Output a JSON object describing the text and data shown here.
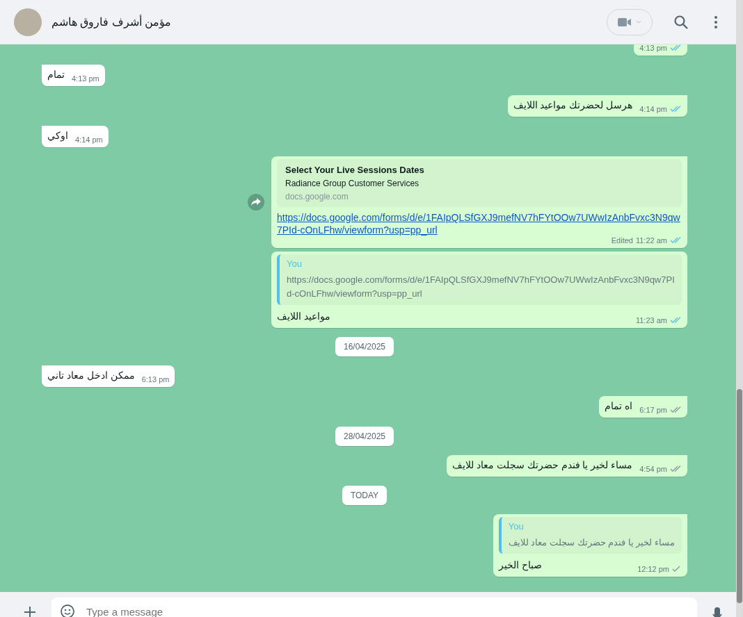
{
  "header": {
    "contact_name": "مؤمن أشرف فاروق هاشم"
  },
  "messages": [
    {
      "kind": "text",
      "outgoing": true,
      "time": "4:13 pm",
      "delivered": true,
      "read": true
    },
    {
      "kind": "text",
      "outgoing": false,
      "text": "تمام",
      "time": "4:13 pm"
    },
    {
      "kind": "text",
      "outgoing": true,
      "text": "هرسل لحضرتك مواعيد اللايف",
      "time": "4:14 pm",
      "delivered": true,
      "read": true
    },
    {
      "kind": "text",
      "outgoing": false,
      "text": "اوكي",
      "time": "4:14 pm"
    },
    {
      "kind": "link",
      "outgoing": true,
      "preview_title": "Select Your Live Sessions Dates",
      "preview_description": "Radiance Group Customer Services",
      "preview_domain": "docs.google.com",
      "url": "https://docs.google.com/forms/d/e/1FAIpQLSfGXJ9mefNV7hFYtOOw7UWwIzAnbFvxc3N9qw7PId-cOnLFhw/viewform?usp=pp_url",
      "edited": "Edited",
      "time": "11:22 am",
      "delivered": true,
      "read": true
    },
    {
      "kind": "reply",
      "outgoing": true,
      "quote_author": "You",
      "quote_text": "https://docs.google.com/forms/d/e/1FAIpQLSfGXJ9mefNV7hFYtOOw7UWwIzAnbFvxc3N9qw7PId-cOnLFhw/viewform?usp=pp_url",
      "text": "مواعيد اللايف",
      "time": "11:23 am",
      "delivered": true,
      "read": true
    },
    {
      "kind": "date",
      "label": "16/04/2025"
    },
    {
      "kind": "text",
      "outgoing": false,
      "text": "ممكن ادخل معاد تاني",
      "time": "6:13 pm"
    },
    {
      "kind": "text",
      "outgoing": true,
      "text": "اه تمام",
      "time": "6:17 pm",
      "delivered": true,
      "read": false
    },
    {
      "kind": "date",
      "label": "28/04/2025"
    },
    {
      "kind": "text",
      "outgoing": true,
      "text": "مساء لخير يا فندم حضرتك سجلت معاد للايف",
      "time": "4:54 pm",
      "delivered": true,
      "read": false
    },
    {
      "kind": "date",
      "label": "TODAY"
    },
    {
      "kind": "reply",
      "outgoing": true,
      "quote_author": "You",
      "quote_text": "مساء لخير يا فندم حضرتك سجلت معاد للايف",
      "text": "صباح الخير",
      "time": "12:12 pm",
      "delivered": false,
      "read": false
    }
  ],
  "composer": {
    "placeholder": "Type a message"
  }
}
